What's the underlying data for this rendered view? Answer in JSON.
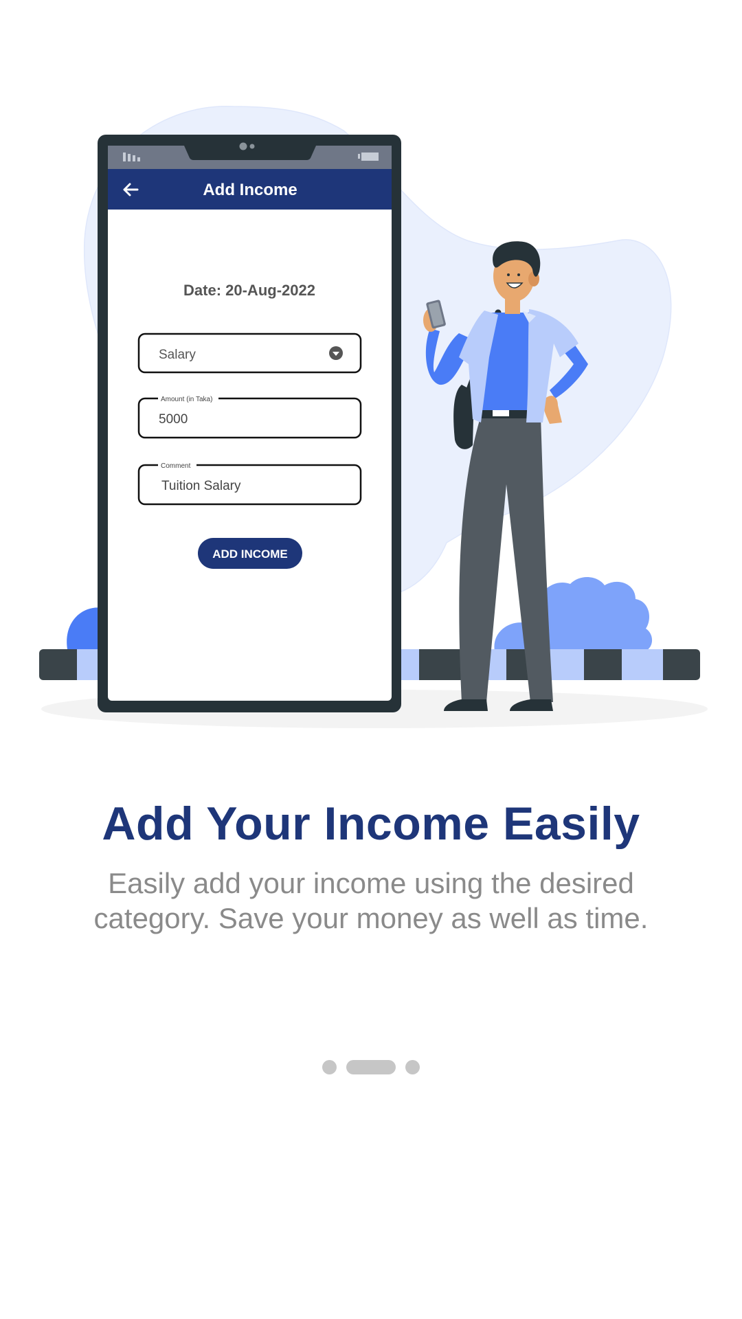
{
  "illustration": {
    "phone_screen": {
      "app_bar": {
        "back_icon": "arrow-left-icon",
        "title": "Add Income"
      },
      "date_label": "Date: 20-Aug-2022",
      "category_dropdown": {
        "selected_value": "Salary",
        "icon": "dropdown-arrow-icon"
      },
      "amount_field": {
        "label": "Amount (in Taka)",
        "value": "5000"
      },
      "comment_field": {
        "label": "Comment",
        "value": "Tuition Salary"
      },
      "submit_button_label": "ADD INCOME"
    }
  },
  "onboarding": {
    "title": "Add Your Income Easily",
    "description": "Easily add your income using the desired category. Save your money as well as time.",
    "pager": {
      "total_pages": 3,
      "active_index": 1
    }
  },
  "colors": {
    "brand_navy": "#1e3679",
    "accent_blue": "#4a7cf6",
    "light_blue": "#b8ccfb",
    "blob_bg": "#eaf0fd",
    "phone_frame": "#263238",
    "pager_dot": "#c6c6c6",
    "description_gray": "#8a8a8a"
  }
}
